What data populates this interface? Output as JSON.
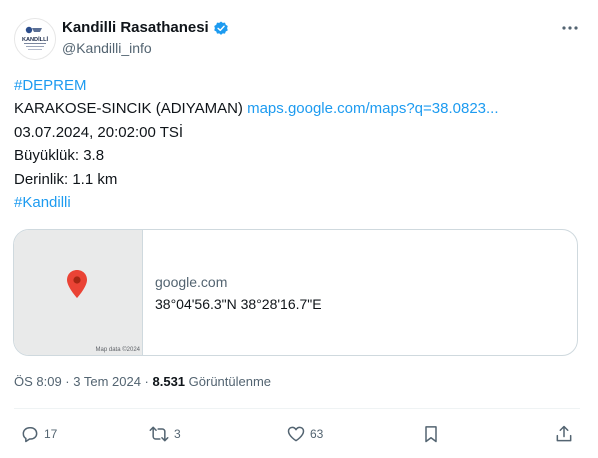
{
  "author": {
    "display_name": "Kandilli Rasathanesi",
    "handle": "@Kandilli_info",
    "logo_text": "KANDİLLİ"
  },
  "tweet": {
    "hashtag_top": "#DEPREM",
    "location_text": "KARAKOSE-SINCIK (ADIYAMAN) ",
    "link_text": "maps.google.com/maps?q=38.0823...",
    "datetime_line": "03.07.2024, 20:02:00 TSİ",
    "magnitude_line": "Büyüklük: 3.8",
    "depth_line": "Derinlik: 1.1 km",
    "hashtag_bottom": "#Kandilli"
  },
  "card": {
    "domain": "google.com",
    "title": "38°04'56.3\"N 38°28'16.7\"E",
    "map_attribution": "Map data ©2024"
  },
  "meta": {
    "time_date": "ÖS 8:09 · 3 Tem 2024 · ",
    "views_count": "8.531",
    "views_label": " Görüntülenme"
  },
  "actions": {
    "replies": "17",
    "retweets": "3",
    "likes": "63"
  },
  "colors": {
    "accent": "#1d9bf0",
    "text": "#0f1419",
    "muted": "#536471",
    "pin": "#ea4335"
  }
}
